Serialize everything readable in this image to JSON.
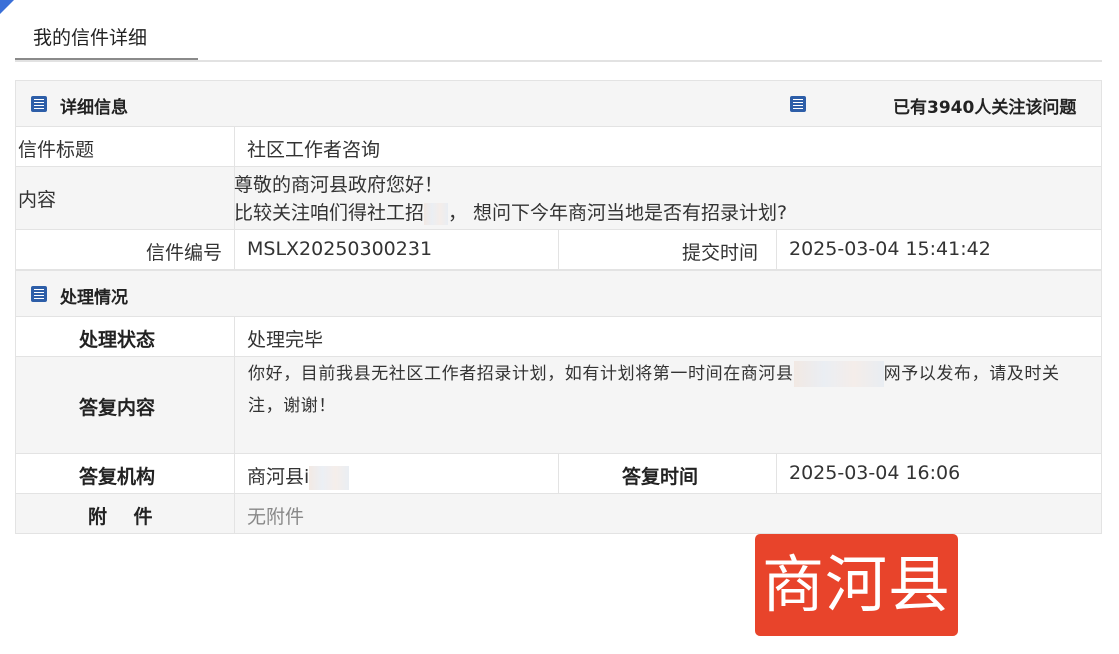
{
  "tab": {
    "label": "我的信件详细"
  },
  "detail_section": {
    "title": "详细信息",
    "follow_text": "已有3940人关注该问题"
  },
  "letter": {
    "title_label": "信件标题",
    "title_value": "社区工作者咨询",
    "content_label": "内容",
    "content_line1": "尊敬的商河县政府您好！",
    "content_line2a": "比较关注咱们得社工招",
    "content_line2b": "，  想问下今年商河当地是否有招录计划?",
    "number_label": "信件编号",
    "number_value": "MSLX20250300231",
    "submit_label": "提交时间",
    "submit_value": "2025-03-04 15:41:42"
  },
  "process_section": {
    "title": "处理情况"
  },
  "process": {
    "status_label": "处理状态",
    "status_value": "处理完毕",
    "reply_label": "答复内容",
    "reply_line1a": "你好，目前我县无社区工作者招录计划，如有计划将第一时间在商河县",
    "reply_line1b": "网予以发布，请及时关",
    "reply_line2": "注，谢谢！",
    "org_label": "答复机构",
    "org_value": "商河县i",
    "reply_time_label": "答复时间",
    "reply_time_value": "2025-03-04 16:06",
    "attach_label": "附    件",
    "attach_value": "无附件"
  },
  "watermark": {
    "text": "商河县",
    "color": "#e8442b"
  }
}
